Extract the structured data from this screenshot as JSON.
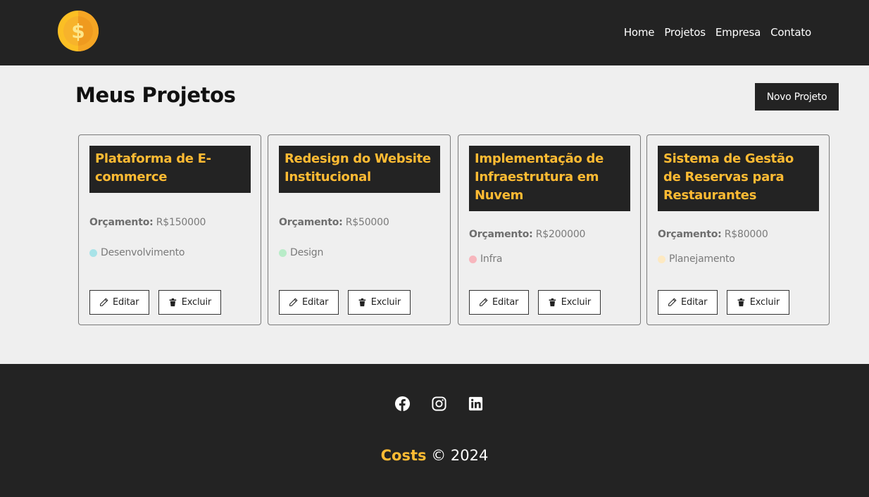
{
  "nav": {
    "logo_icon": "coin-dollar-icon",
    "links": [
      "Home",
      "Projetos",
      "Empresa",
      "Contato"
    ]
  },
  "main": {
    "title": "Meus Projetos",
    "new_project_label": "Novo Projeto",
    "budget_label": "Orçamento:",
    "projects": [
      {
        "name": "Plataforma de E-commerce",
        "budget": "R$150000",
        "category": "Desenvolvimento",
        "color": "#a8e3e8"
      },
      {
        "name": "Redesign do Website Institucional",
        "budget": "R$50000",
        "category": "Design",
        "color": "#b8ecc8"
      },
      {
        "name": "Implementação de Infraestrutura em Nuvem",
        "budget": "R$200000",
        "category": "Infra",
        "color": "#f7b6bd"
      },
      {
        "name": "Sistema de Gestão de Reservas para Restaurantes",
        "budget": "R$80000",
        "category": "Planejamento",
        "color": "#fde9c2"
      }
    ],
    "edit_label": "Editar",
    "delete_label": "Excluir"
  },
  "footer": {
    "socials": [
      "facebook-icon",
      "instagram-icon",
      "linkedin-icon"
    ],
    "brand": "Costs",
    "copyright": "© 2024"
  },
  "colors": {
    "dark": "#232323",
    "accent": "#ffbb33",
    "background": "#efefef"
  }
}
